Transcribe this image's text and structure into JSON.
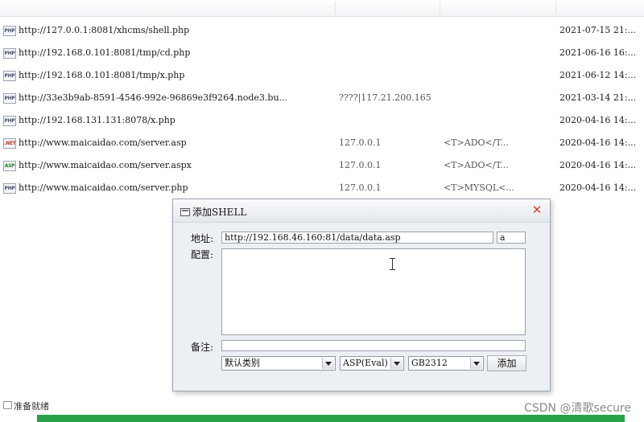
{
  "rows": [
    {
      "type": "PHP",
      "url": "http://127.0.0.1:8081/xhcms/shell.php",
      "ip": "",
      "db": "",
      "date": "2021-07-15 21:..."
    },
    {
      "type": "PHP",
      "url": "http://192.168.0.101:8081/tmp/cd.php",
      "ip": "",
      "db": "",
      "date": "2021-06-16 16:..."
    },
    {
      "type": "PHP",
      "url": "http://192.168.0.101:8081/tmp/x.php",
      "ip": "",
      "db": "",
      "date": "2021-06-12 14:..."
    },
    {
      "type": "PHP",
      "url": "http://33e3b9ab-8591-4546-992e-96869e3f9264.node3.bu...",
      "ip": "????|117.21.200.165",
      "db": "",
      "date": "2021-03-14 21:..."
    },
    {
      "type": "PHP",
      "url": "http://192.168.131.131:8078/x.php",
      "ip": "",
      "db": "",
      "date": "2020-04-16 14:..."
    },
    {
      "type": ".NET",
      "url": "http://www.maicaidao.com/server.asp",
      "ip": "127.0.0.1",
      "db": "<T>ADO</T...",
      "date": "2020-04-16 14:..."
    },
    {
      "type": "ASP",
      "url": "http://www.maicaidao.com/server.aspx",
      "ip": "127.0.0.1",
      "db": "<T>ADO</T...",
      "date": "2020-04-16 14:..."
    },
    {
      "type": "PHP",
      "url": "http://www.maicaidao.com/server.php",
      "ip": "127.0.0.1",
      "db": "<T>MYSQL<...",
      "date": "2020-04-16 14:..."
    }
  ],
  "dialog": {
    "title": "添加SHELL",
    "close_label": "✕",
    "address_label": "地址:",
    "address_value": "http://192.168.46.160:81/data/data.asp",
    "password_value": "a",
    "config_label": "配置:",
    "config_value": "",
    "note_label": "备注:",
    "note_value": "",
    "category_selected": "默认类别",
    "script_type_selected": "ASP(Eval)",
    "encoding_selected": "GB2312",
    "add_button_label": "添加"
  },
  "status": {
    "text": "准备就绪",
    "progress_color": "#2aa24a"
  },
  "watermark": "CSDN @清歌secure"
}
